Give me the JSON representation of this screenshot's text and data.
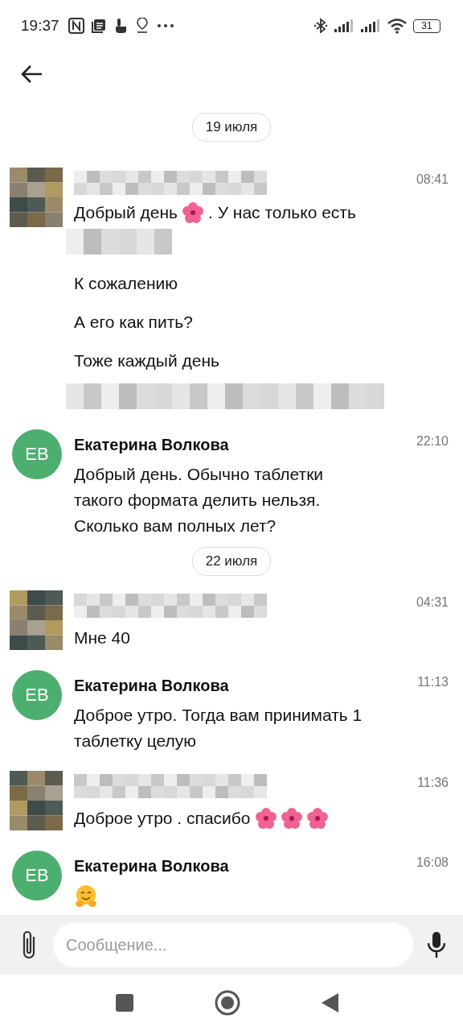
{
  "status_bar": {
    "time": "19:37",
    "battery": "31"
  },
  "feed": [
    {
      "kind": "date",
      "label": "19 июля"
    },
    {
      "kind": "message",
      "author": {
        "kind": "redacted"
      },
      "time": "08:41",
      "lines": [
        {
          "kind": "parts",
          "parts": [
            {
              "kind": "text",
              "text": "Добрый день"
            },
            {
              "kind": "flower"
            },
            {
              "kind": "text",
              "text": ". У нас только есть"
            }
          ]
        },
        {
          "kind": "redacted-word"
        },
        {
          "kind": "parts",
          "parts": [
            {
              "kind": "text",
              "text": "К сожалению"
            }
          ]
        },
        {
          "kind": "parts",
          "parts": [
            {
              "kind": "text",
              "text": "А его как пить?"
            }
          ]
        },
        {
          "kind": "parts",
          "parts": [
            {
              "kind": "text",
              "text": "Тоже каждый день"
            }
          ]
        },
        {
          "kind": "redacted-line"
        }
      ]
    },
    {
      "kind": "message",
      "author": {
        "kind": "named",
        "name": "Екатерина Волкова",
        "initials": "ЕВ"
      },
      "time": "22:10",
      "lines": [
        {
          "kind": "parts",
          "parts": [
            {
              "kind": "text",
              "text": "Добрый день. Обычно таблетки такого формата делить нельзя. Сколько вам полных лет?"
            }
          ]
        }
      ]
    },
    {
      "kind": "date",
      "label": "22 июля"
    },
    {
      "kind": "message",
      "author": {
        "kind": "redacted"
      },
      "time": "04:31",
      "lines": [
        {
          "kind": "parts",
          "parts": [
            {
              "kind": "text",
              "text": "Мне 40"
            }
          ]
        }
      ]
    },
    {
      "kind": "message",
      "author": {
        "kind": "named",
        "name": "Екатерина Волкова",
        "initials": "ЕВ"
      },
      "time": "11:13",
      "lines": [
        {
          "kind": "parts",
          "parts": [
            {
              "kind": "text",
              "text": "Доброе утро. Тогда вам принимать 1 таблетку целую"
            }
          ]
        }
      ]
    },
    {
      "kind": "message",
      "author": {
        "kind": "redacted"
      },
      "time": "11:36",
      "lines": [
        {
          "kind": "parts",
          "parts": [
            {
              "kind": "text",
              "text": "Доброе утро . спасибо"
            },
            {
              "kind": "flower"
            },
            {
              "kind": "flower"
            },
            {
              "kind": "flower"
            }
          ]
        }
      ]
    },
    {
      "kind": "message",
      "author": {
        "kind": "named",
        "name": "Екатерина Волкова",
        "initials": "ЕВ"
      },
      "time": "16:08",
      "lines": [
        {
          "kind": "parts",
          "parts": [
            {
              "kind": "hug"
            }
          ]
        }
      ]
    }
  ],
  "composer": {
    "placeholder": "Сообщение..."
  }
}
